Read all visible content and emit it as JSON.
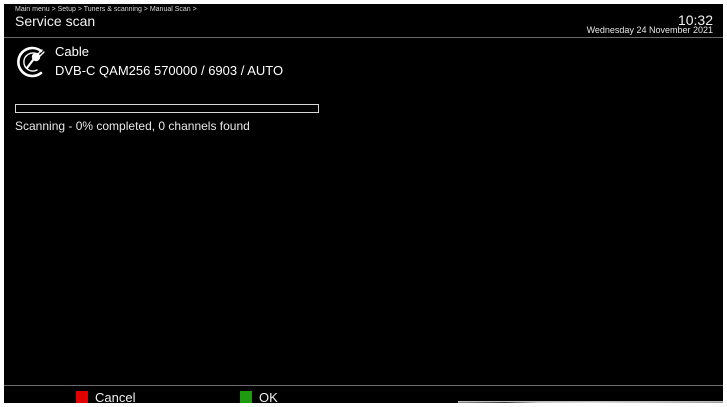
{
  "header": {
    "breadcrumb": "Main menu > Setup > Tuners & scanning > Manual Scan >",
    "title": "Service scan",
    "time": "10:32",
    "date": "Wednesday 24 November 2021"
  },
  "tuner": {
    "icon": "cable-plug-icon",
    "type": "Cable",
    "params": "DVB-C QAM256 570000 / 6903 / AUTO"
  },
  "scan": {
    "progress_percent": 0,
    "status": "Scanning - 0% completed, 0 channels found"
  },
  "footer": {
    "cancel": {
      "label": "Cancel",
      "color": "#e00000"
    },
    "ok": {
      "label": "OK",
      "color": "#1f9a10"
    }
  },
  "colors": {
    "background": "#000000",
    "text": "#e8e8e8",
    "rule": "#6a6a6a"
  }
}
